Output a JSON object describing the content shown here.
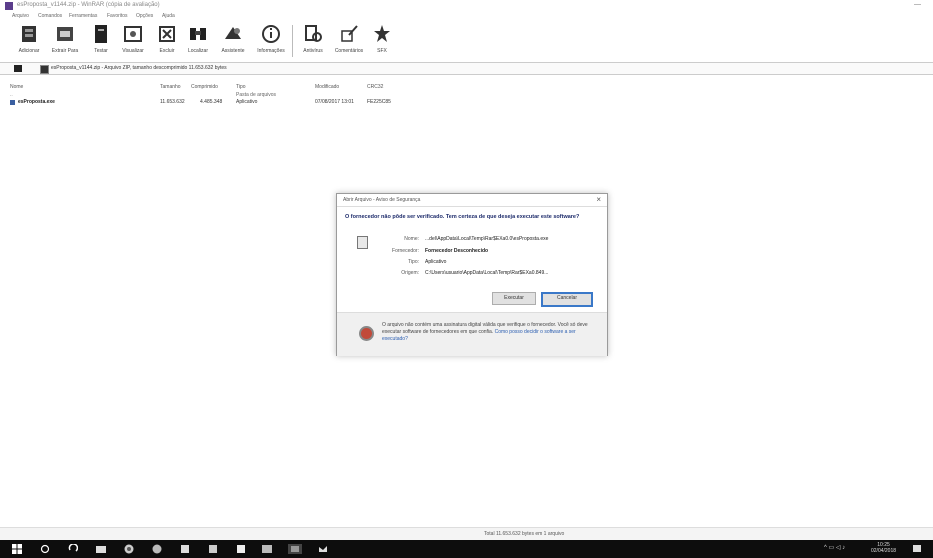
{
  "window": {
    "title": "esProposta_v1144.zip - WinRAR (cópia de avaliação)",
    "minimize_label": "—"
  },
  "menu": [
    "Arquivo",
    "Comandos",
    "Ferramentas",
    "Favoritos",
    "Opções",
    "Ajuda"
  ],
  "toolbar": [
    {
      "label": "Adicionar",
      "icon": "add-icon"
    },
    {
      "label": "Extrair Para",
      "icon": "extract-icon"
    },
    {
      "label": "Testar",
      "icon": "test-icon"
    },
    {
      "label": "Visualizar",
      "icon": "view-icon"
    },
    {
      "label": "Excluir",
      "icon": "delete-icon"
    },
    {
      "label": "Localizar",
      "icon": "find-icon"
    },
    {
      "label": "Assistente",
      "icon": "wizard-icon"
    },
    {
      "label": "Informações",
      "icon": "info-icon"
    },
    {
      "label": "Antivírus",
      "icon": "virus-scan-icon"
    },
    {
      "label": "Comentários",
      "icon": "comment-icon"
    },
    {
      "label": "SFX",
      "icon": "sfx-icon"
    }
  ],
  "path": {
    "text": "esProposta_v1144.zip - Arquivo ZIP, tamanho descomprimido 11.653.632 bytes"
  },
  "columns": [
    "Nome",
    "Tamanho",
    "Comprimido",
    "Tipo",
    "Modificado",
    "CRC32"
  ],
  "rows": [
    {
      "name": "..",
      "size": "",
      "packed": "",
      "type": "Pasta de arquivos",
      "modified": "",
      "crc": ""
    },
    {
      "name": "esProposta.exe",
      "size": "11.653.632",
      "packed": "4.485.348",
      "type": "Aplicativo",
      "modified": "07/08/2017 13:01",
      "crc": "FE225C85"
    }
  ],
  "status": {
    "left": "",
    "right": "Total 11.653.632 bytes em 1 arquivo"
  },
  "dialog": {
    "title": "Abrir Arquivo - Aviso de Segurança",
    "close": "×",
    "heading": "O fornecedor não pôde ser verificado. Tem certeza de que deseja executar este software?",
    "fields": [
      {
        "label": "Nome:",
        "value": "...del\\AppData\\Local\\Temp\\Rar$EXa0.0\\esProposta.exe"
      },
      {
        "label": "Fornecedor:",
        "value": "Fornecedor Desconhecido"
      },
      {
        "label": "Tipo:",
        "value": "Aplicativo"
      },
      {
        "label": "Origem:",
        "value": "C:\\Users\\usuario\\AppData\\Local\\Temp\\Rar$EXa0.849..."
      }
    ],
    "execute_label": "Executar",
    "cancel_label": "Cancelar",
    "footer_text": "O arquivo não contém uma assinatura digital válida que verifique o fornecedor. Você só deve executar software de fornecedores em que confia.",
    "footer_link": "Como posso decidir o software a ser executado?"
  },
  "tray": {
    "time": "10:25",
    "date": "02/04/2018"
  },
  "colors": {
    "accent": "#3a78c8",
    "heading": "#1d2b6b",
    "taskbar": "#0d0d0d"
  }
}
